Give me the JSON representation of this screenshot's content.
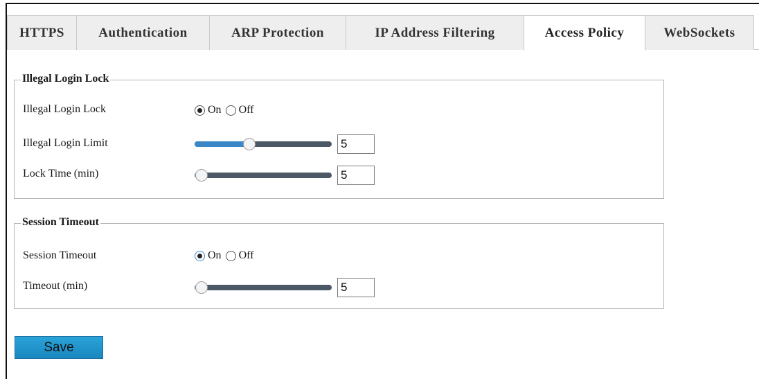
{
  "tabs": [
    {
      "label": "HTTPS",
      "active": false
    },
    {
      "label": "Authentication",
      "active": false
    },
    {
      "label": "ARP Protection",
      "active": false
    },
    {
      "label": "IP Address Filtering",
      "active": false
    },
    {
      "label": "Access Policy",
      "active": true
    },
    {
      "label": "WebSockets",
      "active": false
    }
  ],
  "illegal_login_lock": {
    "legend": "Illegal Login Lock",
    "lock": {
      "label": "Illegal Login Lock",
      "on_label": "On",
      "off_label": "Off",
      "selected": "On"
    },
    "limit": {
      "label": "Illegal Login Limit",
      "value": "5",
      "slider_fraction": 0.4
    },
    "lock_time": {
      "label": "Lock Time (min)",
      "value": "5",
      "slider_fraction": 0.05
    }
  },
  "session_timeout": {
    "legend": "Session Timeout",
    "timeout": {
      "label": "Session Timeout",
      "on_label": "On",
      "off_label": "Off",
      "selected": "On"
    },
    "timeout_min": {
      "label": "Timeout (min)",
      "value": "5",
      "slider_fraction": 0.05
    }
  },
  "actions": {
    "save_label": "Save"
  },
  "colors": {
    "slider_fill": "#3a86c6",
    "slider_track": "#4b5966",
    "button": "#1a87c0"
  }
}
